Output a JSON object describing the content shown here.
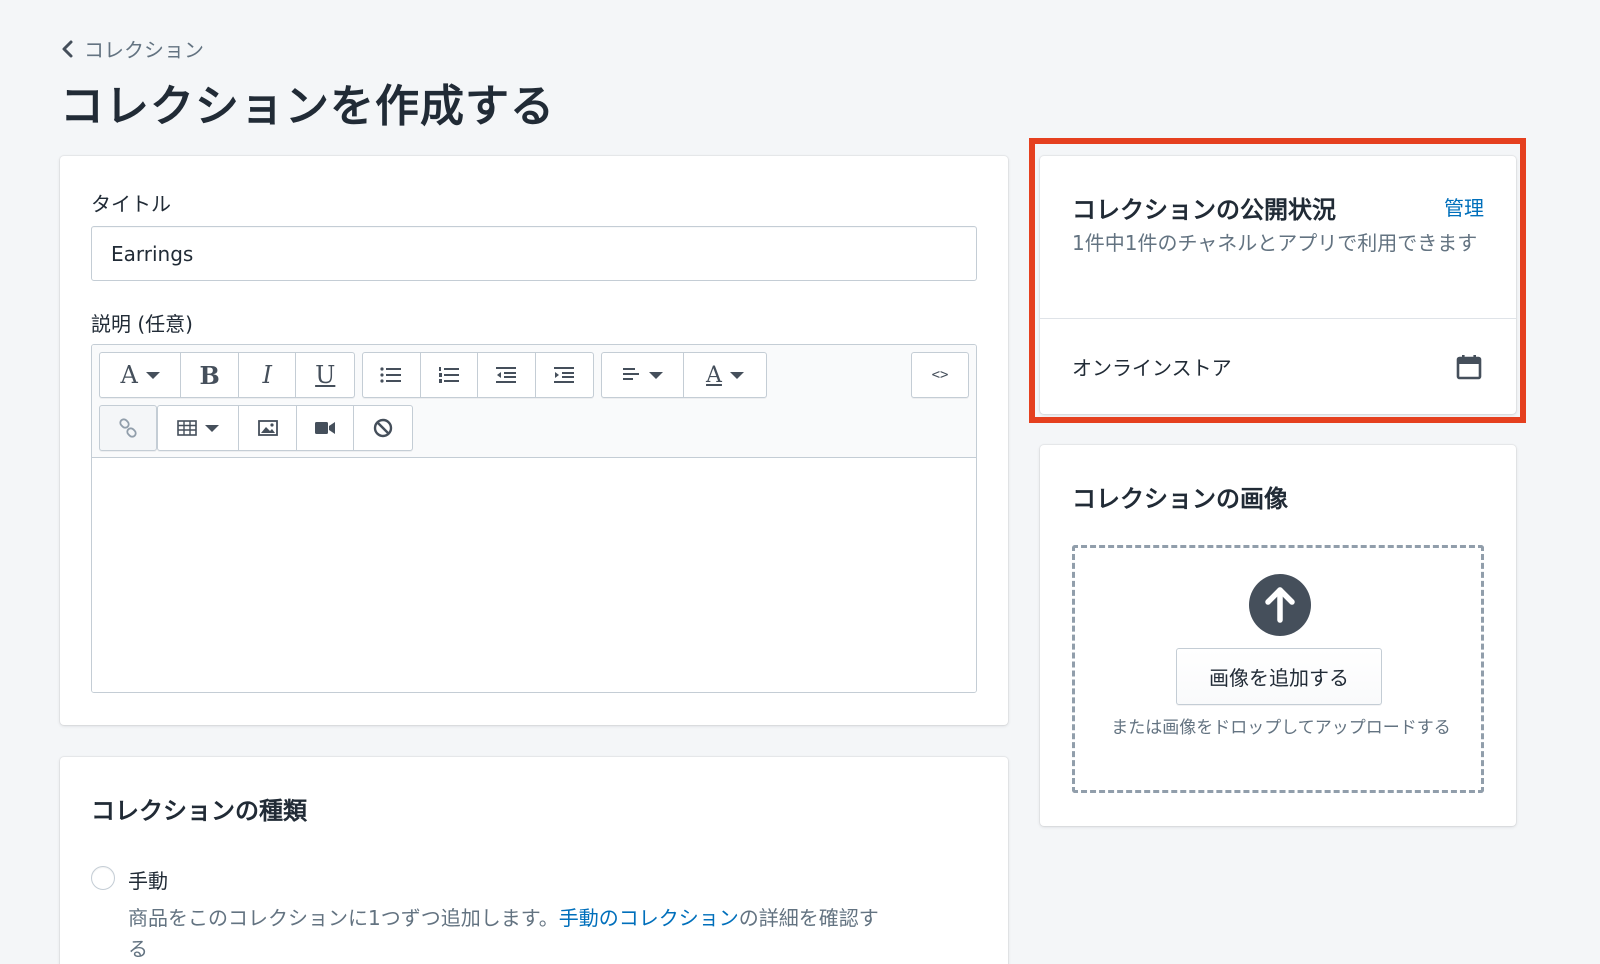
{
  "breadcrumb": {
    "label": "コレクション"
  },
  "page": {
    "title": "コレクションを作成する"
  },
  "form": {
    "title_label": "タイトル",
    "title_value": "Earrings",
    "description_label": "説明 (任意)",
    "toolbar": {
      "font_glyph": "A",
      "bold_glyph": "B",
      "italic_glyph": "I",
      "underline_glyph": "U",
      "color_glyph": "A",
      "code_glyph": "<>"
    }
  },
  "collection_type": {
    "heading": "コレクションの種類",
    "manual_label": "手動",
    "manual_help_prefix": "商品をこのコレクションに1つずつ追加します。",
    "manual_help_link": "手動のコレクション",
    "manual_help_suffix": "の詳細を確認す",
    "manual_help_cont": "る"
  },
  "visibility": {
    "heading": "コレクションの公開状況",
    "manage_link": "管理",
    "subtitle": "1件中1件のチャネルとアプリで利用できます",
    "channel": "オンラインストア"
  },
  "image": {
    "heading": "コレクションの画像",
    "add_button": "画像を追加する",
    "drop_hint": "または画像をドロップしてアップロードする"
  },
  "colors": {
    "highlight_frame": "#e5401f",
    "link": "#006fbb",
    "background": "#f4f6f8"
  }
}
